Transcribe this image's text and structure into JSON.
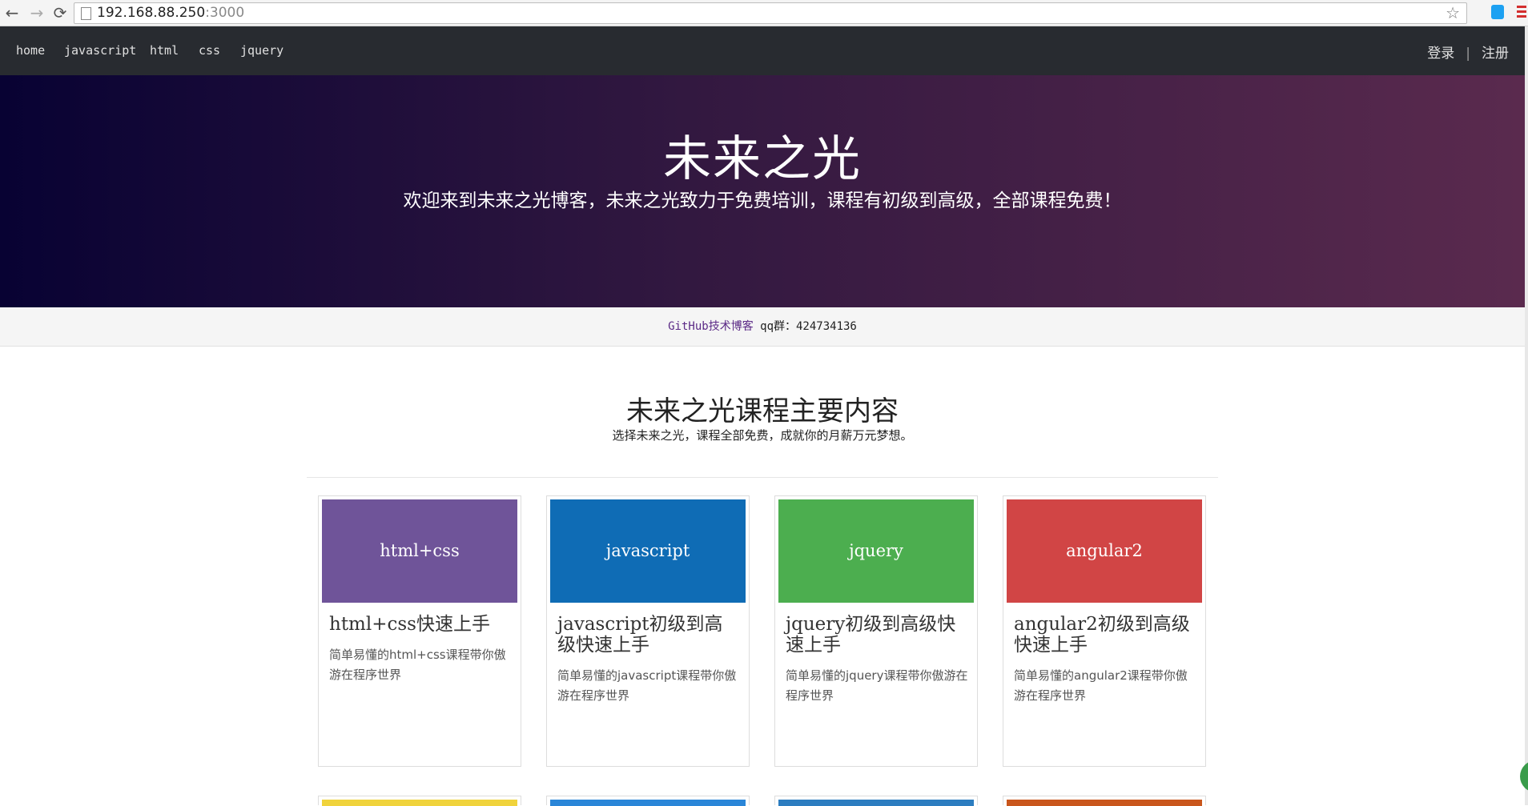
{
  "browser": {
    "url_host": "192.168.88.250",
    "url_port": ":3000",
    "back_icon": "←",
    "forward_icon": "→",
    "reload_icon": "⟳",
    "star_icon": "☆"
  },
  "nav": {
    "links": [
      "home",
      "javascript",
      "html",
      "css",
      "jquery"
    ],
    "login": "登录",
    "separator": "|",
    "register": "注册"
  },
  "hero": {
    "title": "未来之光",
    "subtitle": "欢迎来到未来之光博客，未来之光致力于免费培训，课程有初级到高级，全部课程免费！"
  },
  "infobar": {
    "link": "GitHub技术博客",
    "qq": "qq群：424734136"
  },
  "section": {
    "title": "未来之光课程主要内容",
    "subtitle": "选择未来之光，课程全部免费，成就你的月薪万元梦想。"
  },
  "cards": [
    {
      "thumb": "html+css",
      "color": "#6f5499",
      "title": "html+css快速上手",
      "desc": "简单易懂的html+css课程带你傲游在程序世界"
    },
    {
      "thumb": "javascript",
      "color": "#0f6cb5",
      "title": "javascript初级到高级快速上手",
      "desc": "简单易懂的javascript课程带你傲游在程序世界"
    },
    {
      "thumb": "jquery",
      "color": "#4cae4f",
      "title": "jquery初级到高级快速上手",
      "desc": "简单易懂的jquery课程带你傲游在程序世界"
    },
    {
      "thumb": "angular2",
      "color": "#d14545",
      "title": "angular2初级到高级快速上手",
      "desc": "简单易懂的angular2课程带你傲游在程序世界"
    }
  ],
  "next_row_colors": [
    "#f0d33c",
    "#2a86d8",
    "#2c7dc0",
    "#c9561c"
  ]
}
